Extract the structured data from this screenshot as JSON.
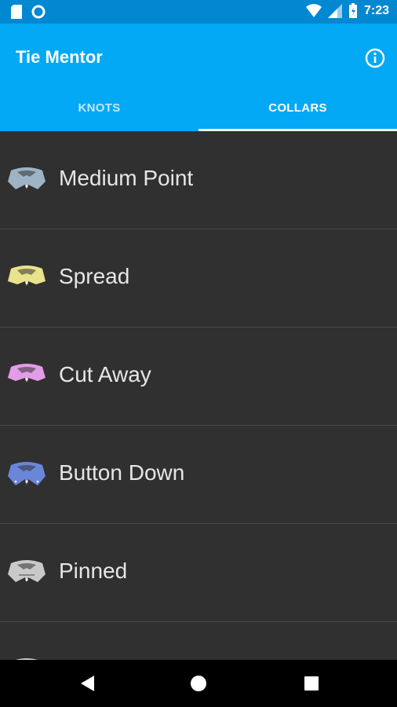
{
  "status_bar": {
    "time": "7:23",
    "icons": [
      "sd-card-icon",
      "circle-icon",
      "wifi-icon",
      "signal-icon",
      "battery-icon"
    ]
  },
  "app": {
    "title": "Tie Mentor",
    "info_icon": "info-icon",
    "accent": "#03a9f4"
  },
  "tabs": [
    {
      "label": "KNOTS",
      "selected": false
    },
    {
      "label": "COLLARS",
      "selected": true
    }
  ],
  "collars": [
    {
      "label": "Medium Point",
      "color": "#9eb3c4"
    },
    {
      "label": "Spread",
      "color": "#e8e38c"
    },
    {
      "label": "Cut Away",
      "color": "#e39ce8"
    },
    {
      "label": "Button Down",
      "color": "#6a86d8"
    },
    {
      "label": "Pinned",
      "color": "#c9c9c9"
    },
    {
      "label": "",
      "color": "#c9c9c9"
    }
  ],
  "nav": [
    "back-icon",
    "home-icon",
    "recents-icon"
  ]
}
